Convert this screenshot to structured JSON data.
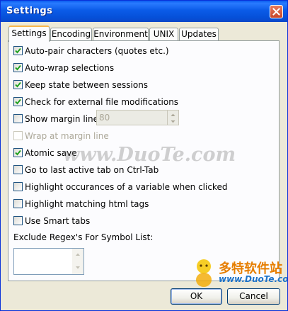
{
  "window": {
    "title": "Settings"
  },
  "tabs": [
    {
      "label": "Settings",
      "active": true
    },
    {
      "label": "Encoding",
      "active": false
    },
    {
      "label": "Environment",
      "active": false
    },
    {
      "label": "UNIX",
      "active": false
    },
    {
      "label": "Updates",
      "active": false
    }
  ],
  "options": [
    {
      "label": "Auto-pair characters (quotes etc.)",
      "checked": true,
      "enabled": true
    },
    {
      "label": "Auto-wrap selections",
      "checked": true,
      "enabled": true
    },
    {
      "label": "Keep state between sessions",
      "checked": true,
      "enabled": true
    },
    {
      "label": "Check for external file modifications",
      "checked": true,
      "enabled": true
    },
    {
      "label": "Show margin line",
      "checked": false,
      "enabled": true
    },
    {
      "label": "Wrap at margin line",
      "checked": false,
      "enabled": false
    },
    {
      "label": "Atomic save",
      "checked": true,
      "enabled": true
    },
    {
      "label": "Go to last active tab on Ctrl-Tab",
      "checked": false,
      "enabled": true
    },
    {
      "label": "Highlight occurances of a variable when clicked",
      "checked": false,
      "enabled": true
    },
    {
      "label": "Highlight matching html tags",
      "checked": false,
      "enabled": true
    },
    {
      "label": "Use Smart tabs",
      "checked": false,
      "enabled": true
    }
  ],
  "margin_spin": {
    "value": "80",
    "enabled": false
  },
  "regex": {
    "label": "Exclude Regex's For Symbol List:",
    "value": ""
  },
  "buttons": {
    "ok": "OK",
    "cancel": "Cancel"
  },
  "watermark": {
    "main": "www.DuoTe.com",
    "logo_cn": "多特软件站",
    "logo_url": "www.DuoTe.com"
  },
  "colors": {
    "title_bar": "#0A5DF0",
    "window_bg": "#ECE9D8",
    "close_button": "#C8452A",
    "active_tab_highlight": "#F7B64C"
  }
}
